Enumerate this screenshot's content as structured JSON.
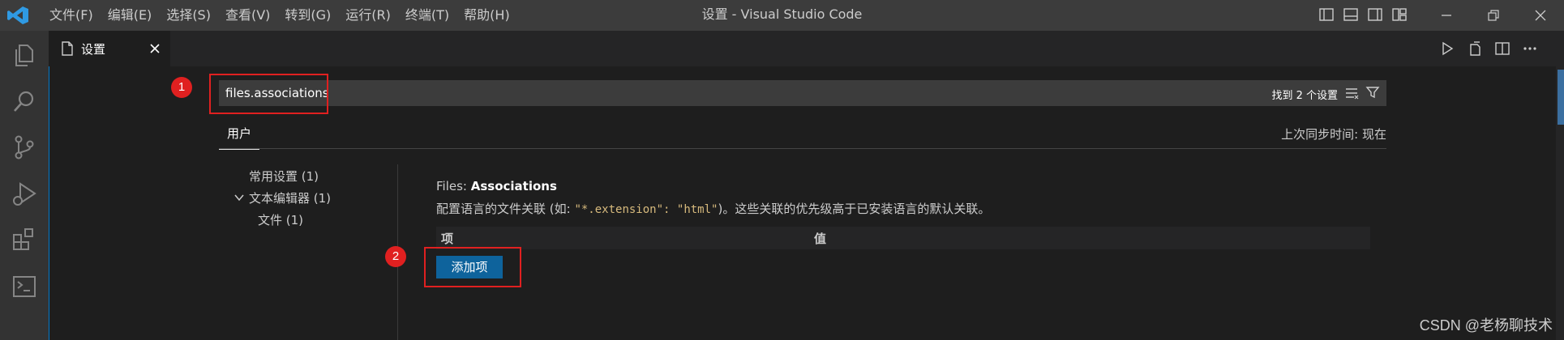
{
  "menu": [
    "文件(F)",
    "编辑(E)",
    "选择(S)",
    "查看(V)",
    "转到(G)",
    "运行(R)",
    "终端(T)",
    "帮助(H)"
  ],
  "window_title": "设置 - Visual Studio Code",
  "tab": {
    "label": "设置"
  },
  "search": {
    "value": "files.associations",
    "result_count": "找到 2 个设置"
  },
  "scope": {
    "user_tab": "用户",
    "sync_status": "上次同步时间: 现在"
  },
  "toc": {
    "common": "常用设置 (1)",
    "text_editor": "文本编辑器 (1)",
    "files": "文件 (1)"
  },
  "setting": {
    "category": "Files: ",
    "name": "Associations",
    "description_prefix": "配置语言的文件关联 (如: ",
    "code_key": "\"*.extension\"",
    "code_sep": ": ",
    "code_value": "\"html\"",
    "description_suffix": ")。这些关联的优先级高于已安装语言的默认关联。",
    "column_item": "项",
    "column_value": "值",
    "add_button": "添加项"
  },
  "callouts": {
    "one": "1",
    "two": "2"
  },
  "watermark": "CSDN @老杨聊技术",
  "colors": {
    "accent": "#007acc",
    "button": "#0e639c",
    "callout": "#e02020"
  }
}
